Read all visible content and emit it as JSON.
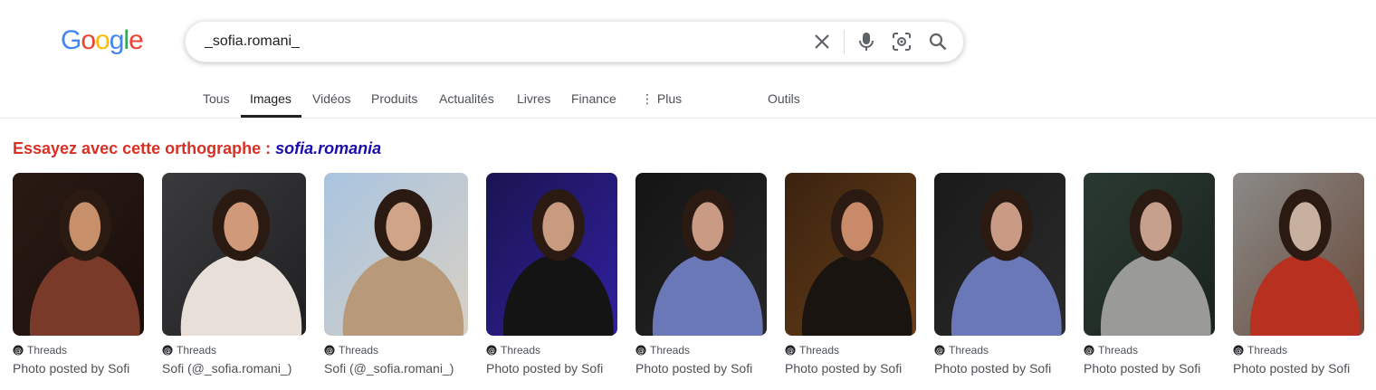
{
  "logo": {
    "letters": [
      "G",
      "o",
      "o",
      "g",
      "l",
      "e"
    ],
    "colors": [
      "#4285F4",
      "#EA4335",
      "#FBBC05",
      "#4285F4",
      "#34A853",
      "#EA4335"
    ]
  },
  "search": {
    "query": "_sofia.romani_"
  },
  "tabs": [
    {
      "label": "Tous"
    },
    {
      "label": "Images"
    },
    {
      "label": "Vidéos"
    },
    {
      "label": "Produits"
    },
    {
      "label": "Actualités"
    },
    {
      "label": "Livres"
    },
    {
      "label": "Finance"
    },
    {
      "label": "⋮ Plus"
    },
    {
      "label": "Outils"
    }
  ],
  "spelling": {
    "prefix": "Essayez avec cette orthographe : ",
    "suggestion": "sofia.romania"
  },
  "results": [
    {
      "source": "Threads",
      "caption": "Photo posted by Sofi",
      "palette": [
        "#2a1a14",
        "#1a0e0a",
        "#7a3a2a",
        "#c8906a"
      ]
    },
    {
      "source": "Threads",
      "caption": "Sofi (@_sofia.romani_)",
      "palette": [
        "#3a3a3c",
        "#202022",
        "#e8e0d8",
        "#d09a7a"
      ]
    },
    {
      "source": "Threads",
      "caption": "Sofi (@_sofia.romani_)",
      "palette": [
        "#a9c4e0",
        "#d8d0c4",
        "#b89a7a",
        "#cfa488"
      ]
    },
    {
      "source": "Threads",
      "caption": "Photo posted by Sofi",
      "palette": [
        "#1a1450",
        "#3020a0",
        "#141414",
        "#c89a80"
      ]
    },
    {
      "source": "Threads",
      "caption": "Photo posted by Sofi",
      "palette": [
        "#141414",
        "#262626",
        "#6a78b8",
        "#c99a84"
      ]
    },
    {
      "source": "Threads",
      "caption": "Photo posted by Sofi",
      "palette": [
        "#3a2210",
        "#6a4018",
        "#1a1410",
        "#c88a68"
      ]
    },
    {
      "source": "Threads",
      "caption": "Photo posted by Sofi",
      "palette": [
        "#1a1a1a",
        "#2a2a2a",
        "#6a78b8",
        "#c99a84"
      ]
    },
    {
      "source": "Threads",
      "caption": "Photo posted by Sofi",
      "palette": [
        "#2a3a30",
        "#1a221e",
        "#9a9a98",
        "#c6a08c"
      ]
    },
    {
      "source": "Threads",
      "caption": "Photo posted by Sofi",
      "palette": [
        "#8a8a88",
        "#6a4a3a",
        "#b83020",
        "#c8b0a0"
      ]
    }
  ]
}
